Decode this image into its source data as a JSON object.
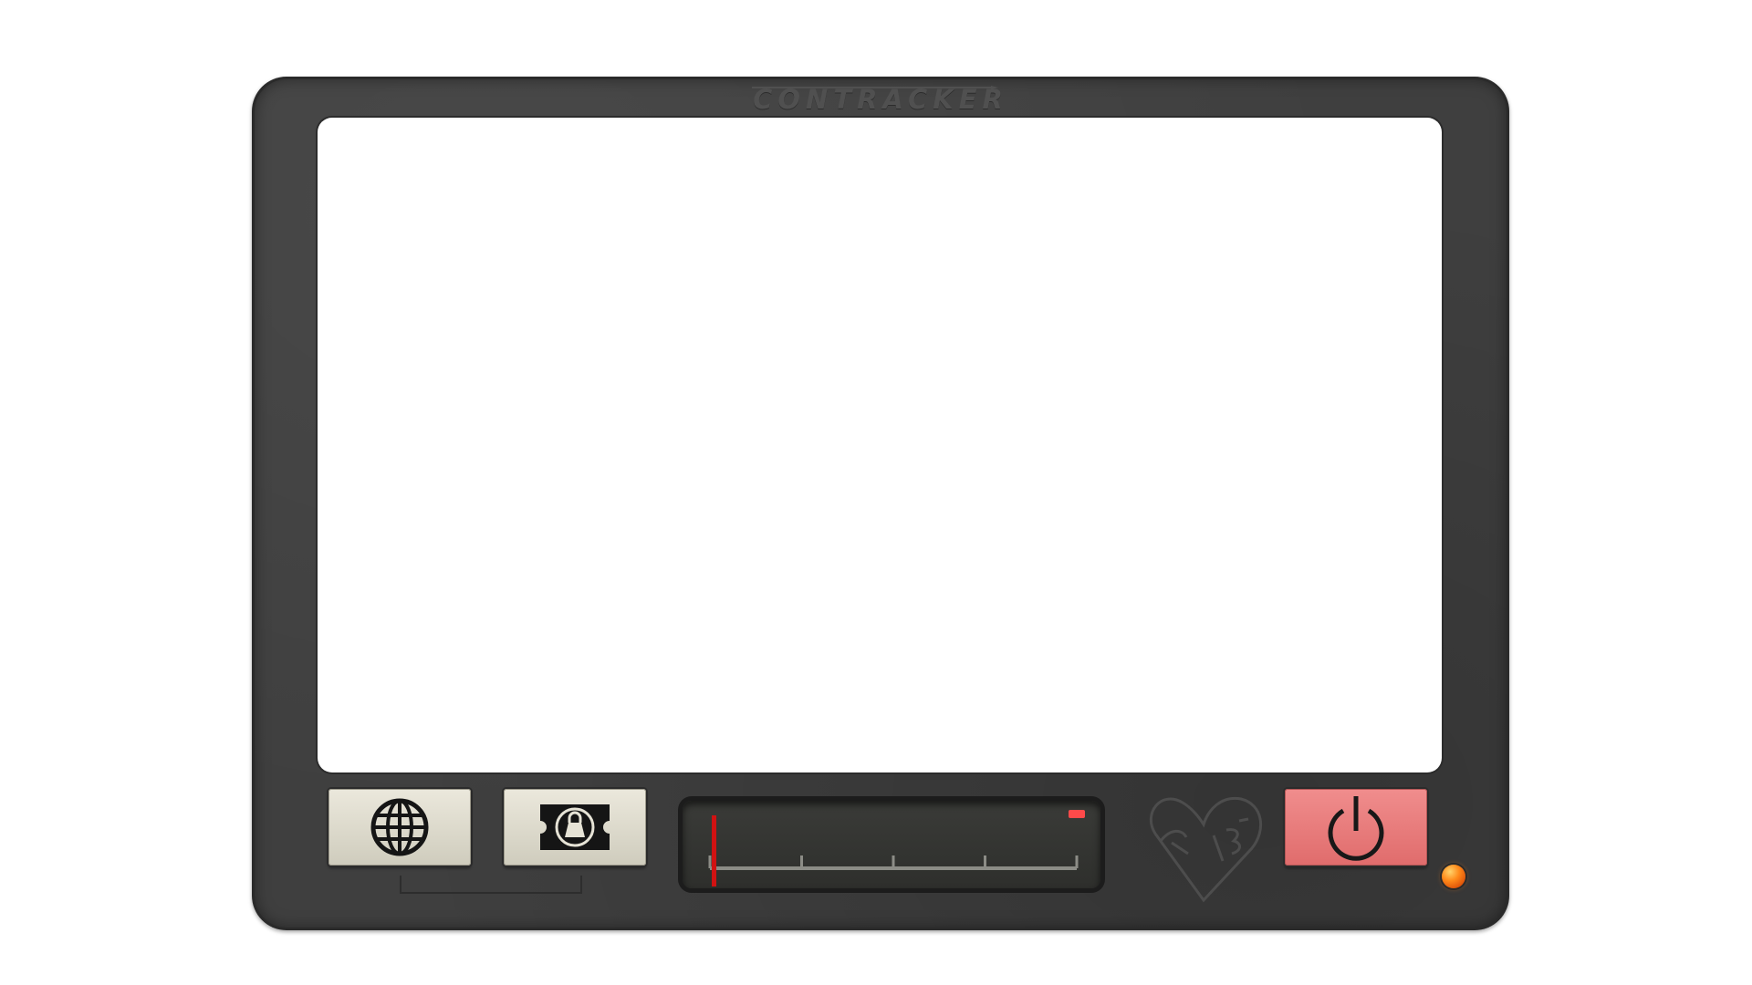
{
  "device": {
    "brand": "CONTRACKER"
  },
  "controls": {
    "globe_button_icon": "globe-icon",
    "ticket_button_icon": "ticket-icon",
    "power_button_icon": "power-icon"
  },
  "meter": {
    "needle_level": 0.01,
    "tick_count": 5,
    "needle_color": "#d11212",
    "peak_indicator_color": "#ff4a4a"
  },
  "indicator_light": {
    "color": "#ff8a1a"
  },
  "colors": {
    "frame": "#3f3f3f",
    "button_face": "#e0ddd0",
    "power_button": "#e87a7a"
  }
}
